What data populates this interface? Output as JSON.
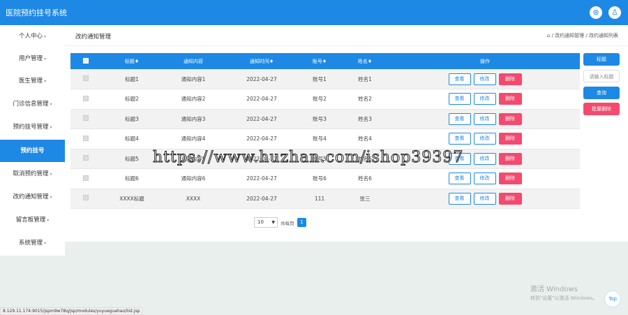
{
  "app": {
    "title": "医院预约挂号系统"
  },
  "header": {
    "icon_1": "crosshair-icon",
    "icon_2": "user-icon",
    "icon_1_glyph": "⊛",
    "icon_2_glyph": "♙"
  },
  "sidebar": {
    "items": [
      {
        "label": "个人中心",
        "caret": "▾",
        "active": false
      },
      {
        "label": "用户管理",
        "caret": "▾",
        "active": false
      },
      {
        "label": "医生管理",
        "caret": "▾",
        "active": false
      },
      {
        "label": "门诊信息管理",
        "caret": "▾",
        "active": false
      },
      {
        "label": "预约挂号管理",
        "caret": "▾",
        "active": false
      },
      {
        "label": "预约挂号",
        "caret": "",
        "active": true
      },
      {
        "label": "取消预约管理",
        "caret": "▾",
        "active": false
      },
      {
        "label": "改约通知管理",
        "caret": "▾",
        "active": false
      },
      {
        "label": "留言板管理",
        "caret": "▾",
        "active": false
      },
      {
        "label": "系统管理",
        "caret": "▾",
        "active": false
      }
    ]
  },
  "page": {
    "title": "改约通知管理",
    "breadcrumb": "/ 改约通知管理 / 改约通知列表",
    "home_icon": "⌂"
  },
  "table": {
    "columns": [
      "标题♦",
      "通知内容",
      "通知时间♦",
      "账号♦",
      "姓名♦",
      "操作"
    ],
    "rows": [
      {
        "title": "标题1",
        "content": "通知内容1",
        "time": "2022-04-27",
        "account": "账号1",
        "name": "姓名1"
      },
      {
        "title": "标题2",
        "content": "通知内容2",
        "time": "2022-04-27",
        "account": "账号2",
        "name": "姓名2"
      },
      {
        "title": "标题3",
        "content": "通知内容3",
        "time": "2022-04-27",
        "account": "账号3",
        "name": "姓名3"
      },
      {
        "title": "标题4",
        "content": "通知内容4",
        "time": "2022-04-27",
        "account": "账号4",
        "name": "姓名4"
      },
      {
        "title": "标题5",
        "content": "通知内容5",
        "time": "2022-04-27",
        "account": "账号5",
        "name": "姓名5"
      },
      {
        "title": "标题6",
        "content": "通知内容6",
        "time": "2022-04-27",
        "account": "账号6",
        "name": "姓名6"
      },
      {
        "title": "XXXX标题",
        "content": "XXXX",
        "time": "2022-04-27",
        "account": "111",
        "name": "张三"
      }
    ],
    "actions": {
      "view": "查看",
      "edit": "修改",
      "delete": "删除"
    }
  },
  "right_panel": {
    "label": "标题",
    "input_placeholder": "请输入标题",
    "search": "查询",
    "batch_delete": "批量删除"
  },
  "pagination": {
    "page_size": "10",
    "total_text": "共每页",
    "current_page": "1"
  },
  "overlay": {
    "watermark": "https://www.huzhan.com/ishop39397",
    "activate_l1": "激活 Windows",
    "activate_l2": "转到\"设置\"以激活 Windows。",
    "top_button": "Top",
    "status_url": "8.129.11.174:9015/jspm9w78q/jsp/modules/yuyueguahao/list.jsp"
  },
  "colors": {
    "primary": "#1e88e5",
    "danger": "#f44a6e"
  }
}
